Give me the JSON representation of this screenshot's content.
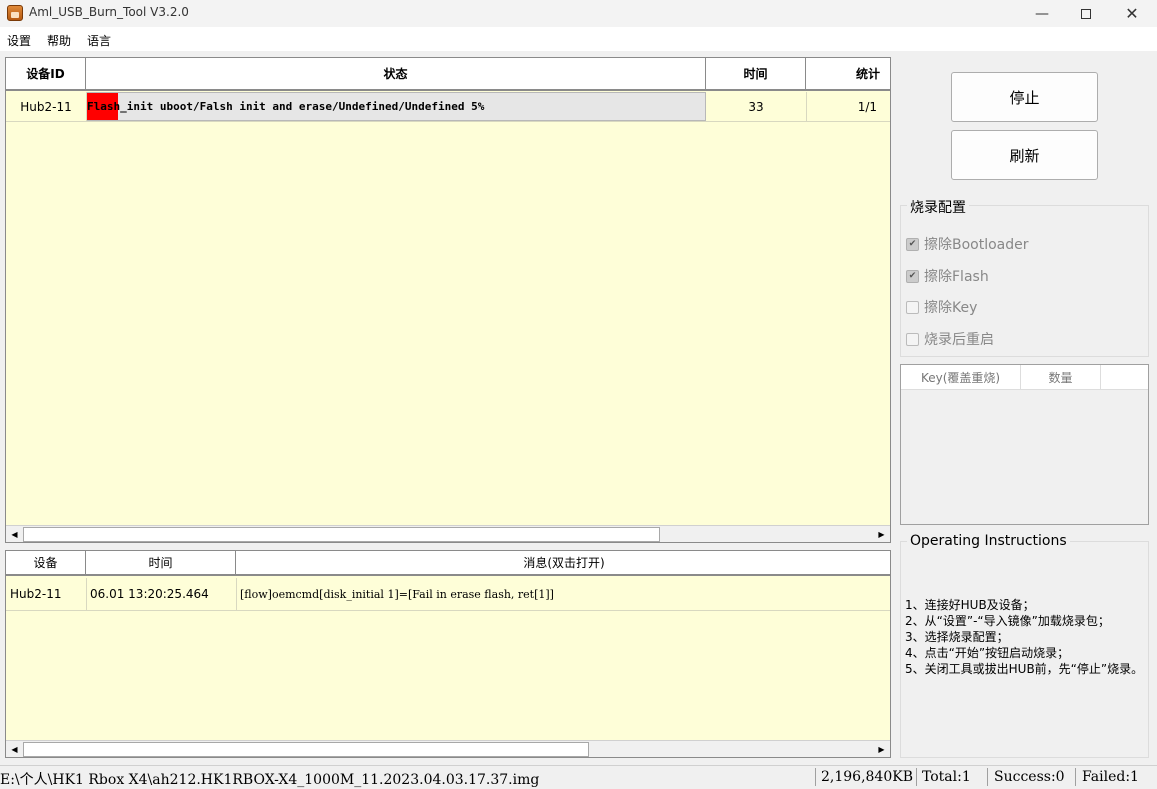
{
  "window": {
    "title": "Aml_USB_Burn_Tool V3.2.0",
    "icons": {
      "app": "app-icon",
      "minimize": "minimize-icon",
      "maximize": "maximize-icon",
      "close": "close-icon"
    }
  },
  "menu": [
    "设置",
    "帮助",
    "语言"
  ],
  "device_table": {
    "columns": [
      "设备ID",
      "状态",
      "时间",
      "统计"
    ],
    "rows": [
      {
        "device_id": "Hub2-11",
        "status": "Flash_init uboot/Falsh init and erase/Undefined/Undefined 5%",
        "progress_percent": 5,
        "time": "33",
        "stats": "1/1"
      }
    ]
  },
  "log_table": {
    "columns": [
      "设备",
      "时间",
      "消息(双击打开)"
    ],
    "rows": [
      {
        "device": "Hub2-11",
        "time": "06.01 13:20:25.464",
        "message": "[flow]oemcmd[disk_initial 1]=[Fail in erase flash, ret[1]]"
      }
    ]
  },
  "buttons": {
    "stop": "停止",
    "refresh": "刷新"
  },
  "burn_config": {
    "title": "烧录配置",
    "options": [
      {
        "label": "擦除Bootloader",
        "checked": true,
        "enabled": false
      },
      {
        "label": "擦除Flash",
        "checked": true,
        "enabled": false
      },
      {
        "label": "擦除Key",
        "checked": false,
        "enabled": false
      },
      {
        "label": "烧录后重启",
        "checked": false,
        "enabled": false
      }
    ]
  },
  "key_table": {
    "columns": [
      "Key(覆盖重烧)",
      "数量"
    ]
  },
  "instructions": {
    "title": "Operating Instructions",
    "lines": [
      "1、连接好HUB及设备；",
      "2、从“设置”-“导入镜像”加载烧录包；",
      "3、选择烧录配置；",
      "4、点击“开始”按钮启动烧录；",
      "5、关闭工具或拔出HUB前，先“停止”烧录。"
    ]
  },
  "status_bar": {
    "image_path": "E:\\个人\\HK1 Rbox X4\\ah212.HK1RBOX-X4_1000M_11.2023.04.03.17.37.img",
    "size": "2,196,840KB",
    "total": "Total:1",
    "success": "Success:0",
    "failed": "Failed:1"
  },
  "colors": {
    "table_bg": "#fefed8",
    "progress": "#ff0000",
    "window_bg": "#f0f0f0"
  }
}
